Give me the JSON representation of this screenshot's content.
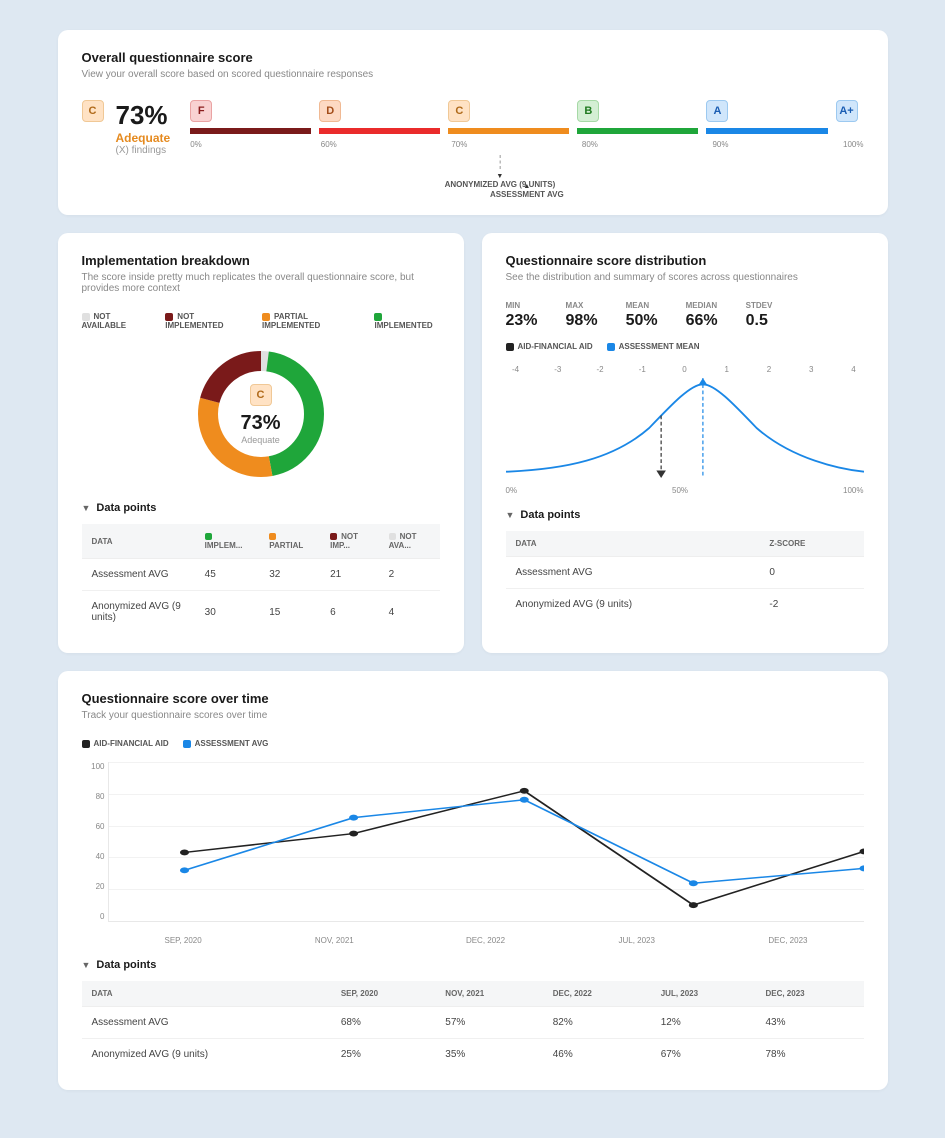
{
  "overall": {
    "title": "Overall questionnaire score",
    "subtitle": "View your overall score based on scored questionnaire responses",
    "grade": "C",
    "percent": "73%",
    "status": "Adequate",
    "findings": "(X) findings",
    "grades": [
      "F",
      "D",
      "C",
      "B",
      "A",
      "A+"
    ],
    "ticks": [
      "0%",
      "60%",
      "70%",
      "80%",
      "90%",
      "100%"
    ],
    "marker1": "ANONYMIZED AVG (9 UNITS)",
    "marker2": "ASSESSMENT AVG"
  },
  "impl": {
    "title": "Implementation breakdown",
    "subtitle": "The score inside pretty much replicates the overall questionnaire score, but provides more context",
    "legend": {
      "na": "NOT AVAILABLE",
      "ni": "NOT IMPLEMENTED",
      "pi": "PARTIAL IMPLEMENTED",
      "im": "IMPLEMENTED"
    },
    "center_grade": "C",
    "center_pct": "73%",
    "center_status": "Adequate",
    "dp_title": "Data points",
    "cols": [
      "DATA",
      "IMPLEM...",
      "PARTIAL",
      "NOT IMP...",
      "NOT AVA..."
    ],
    "rows": [
      [
        "Assessment AVG",
        "45",
        "32",
        "21",
        "2"
      ],
      [
        "Anonymized AVG (9 units)",
        "30",
        "15",
        "6",
        "4"
      ]
    ]
  },
  "dist": {
    "title": "Questionnaire score distribution",
    "subtitle": "See the distribution and summary of scores across questionnaires",
    "stats": [
      {
        "l": "MIN",
        "v": "23%"
      },
      {
        "l": "MAX",
        "v": "98%"
      },
      {
        "l": "MEAN",
        "v": "50%"
      },
      {
        "l": "MEDIAN",
        "v": "66%"
      },
      {
        "l": "STDEV",
        "v": "0.5"
      }
    ],
    "legend": {
      "aid": "AID-FINANCIAL AID",
      "mean": "ASSESSMENT MEAN"
    },
    "axis": [
      "-4",
      "-3",
      "-2",
      "-1",
      "0",
      "1",
      "2",
      "3",
      "4"
    ],
    "bottom": [
      "0%",
      "50%",
      "100%"
    ],
    "dp_title": "Data points",
    "cols": [
      "DATA",
      "Z-SCORE"
    ],
    "rows": [
      [
        "Assessment AVG",
        "0"
      ],
      [
        "Anonymized AVG (9 units)",
        "-2"
      ]
    ]
  },
  "time": {
    "title": "Questionnaire score over time",
    "subtitle": "Track your questionnaire scores over time",
    "legend": {
      "aid": "AID-FINANCIAL AID",
      "avg": "ASSESSMENT AVG"
    },
    "y": [
      "100",
      "80",
      "60",
      "40",
      "20",
      "0"
    ],
    "x": [
      "SEP, 2020",
      "NOV, 2021",
      "DEC, 2022",
      "JUL, 2023",
      "DEC, 2023"
    ],
    "dp_title": "Data points",
    "cols": [
      "DATA",
      "SEP, 2020",
      "NOV, 2021",
      "DEC, 2022",
      "JUL, 2023",
      "DEC, 2023"
    ],
    "rows": [
      [
        "Assessment AVG",
        "68%",
        "57%",
        "82%",
        "12%",
        "43%"
      ],
      [
        "Anonymized AVG (9 units)",
        "25%",
        "35%",
        "46%",
        "67%",
        "78%"
      ]
    ]
  },
  "chart_data": [
    {
      "type": "bar",
      "title": "Overall questionnaire score grade scale",
      "categories": [
        "F",
        "D",
        "C",
        "B",
        "A",
        "A+"
      ],
      "range_ticks": [
        0,
        60,
        70,
        80,
        90,
        100
      ],
      "score_percent": 73,
      "markers": [
        {
          "label": "ANONYMIZED AVG (9 UNITS)",
          "approx_percent": 73
        },
        {
          "label": "ASSESSMENT AVG",
          "approx_percent": 75
        }
      ]
    },
    {
      "type": "pie",
      "title": "Implementation breakdown",
      "series": [
        {
          "name": "IMPLEMENTED",
          "value": 45
        },
        {
          "name": "PARTIAL IMPLEMENTED",
          "value": 32
        },
        {
          "name": "NOT IMPLEMENTED",
          "value": 21
        },
        {
          "name": "NOT AVAILABLE",
          "value": 2
        }
      ],
      "center_label": "73% Adequate"
    },
    {
      "type": "line",
      "title": "Questionnaire score distribution",
      "xlabel": "z-score",
      "x": [
        -4,
        -3,
        -2,
        -1,
        0,
        1,
        2,
        3,
        4
      ],
      "series": [
        {
          "name": "distribution",
          "values": [
            2,
            5,
            12,
            30,
            60,
            30,
            12,
            5,
            2
          ]
        }
      ],
      "markers": [
        {
          "name": "ASSESSMENT MEAN",
          "z": 0
        },
        {
          "name": "AID-FINANCIAL AID",
          "z": -1
        }
      ],
      "stats": {
        "min": 23,
        "max": 98,
        "mean": 50,
        "median": 66,
        "stdev": 0.5
      }
    },
    {
      "type": "line",
      "title": "Questionnaire score over time",
      "categories": [
        "SEP, 2020",
        "NOV, 2021",
        "DEC, 2022",
        "JUL, 2023",
        "DEC, 2023"
      ],
      "ylim": [
        0,
        100
      ],
      "series": [
        {
          "name": "AID-FINANCIAL AID",
          "values": [
            43,
            55,
            82,
            10,
            44
          ]
        },
        {
          "name": "ASSESSMENT AVG",
          "values": [
            32,
            65,
            76,
            24,
            33
          ]
        }
      ]
    }
  ]
}
